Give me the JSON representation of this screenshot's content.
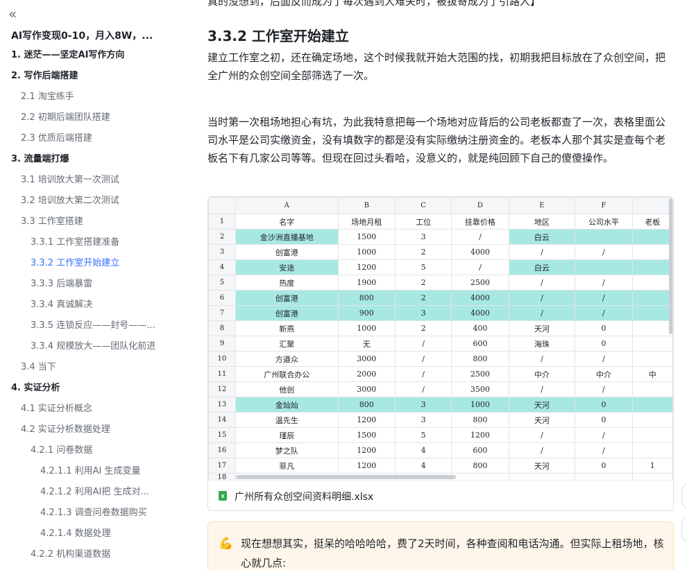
{
  "sidebar": {
    "collapse_icon": "double-chevron-left-icon",
    "collapse_glyph": "«",
    "title": "AI写作变现0-10，月入8W，...",
    "items": [
      {
        "label": "1. 迷茫——坚定AI写作方向",
        "level": 1
      },
      {
        "label": "2. 写作后端搭建",
        "level": 1
      },
      {
        "label": "2.1 淘宝练手",
        "level": 2
      },
      {
        "label": "2.2 初期后端团队搭建",
        "level": 2
      },
      {
        "label": "2.3 优质后端搭建",
        "level": 2
      },
      {
        "label": "3. 流量端打爆",
        "level": 1
      },
      {
        "label": "3.1 培训放大第一次测试",
        "level": 2
      },
      {
        "label": "3.2 培训放大第二次测试",
        "level": 2
      },
      {
        "label": "3.3 工作室搭建",
        "level": 2
      },
      {
        "label": "3.3.1 工作室搭建准备",
        "level": 3
      },
      {
        "label": "3.3.2 工作室开始建立",
        "level": 3,
        "active": true
      },
      {
        "label": "3.3.3 后端暴雷",
        "level": 3
      },
      {
        "label": "3.3.4 真诚解决",
        "level": 3
      },
      {
        "label": "3.3.5 连锁反应——封号——...",
        "level": 3
      },
      {
        "label": "3.3.4 规模放大——团队化前进",
        "level": 3
      },
      {
        "label": "3.4 当下",
        "level": 2
      },
      {
        "label": "4. 实证分析",
        "level": 1
      },
      {
        "label": "4.1 实证分析概念",
        "level": 2
      },
      {
        "label": "4.2 实证分析数据处理",
        "level": 2
      },
      {
        "label": "4.2.1 问卷数据",
        "level": 3
      },
      {
        "label": "4.2.1.1 利用AI 生成变量",
        "level": 4
      },
      {
        "label": "4.2.1.2 利用AI把 生成对...",
        "level": 4
      },
      {
        "label": "4.2.1.3 调查问卷数据购买",
        "level": 4
      },
      {
        "label": "4.2.1.4 数据处理",
        "level": 4
      },
      {
        "label": "4.2.2 机构渠道数据",
        "level": 3
      }
    ]
  },
  "main": {
    "cut_text": "真的没想到，后面反而成为了每次遇到大难关时，被拔寄成为了引路人】",
    "heading": "3.3.2 工作室开始建立",
    "para1": "建立工作室之初，还在确定场地，这个时候我就开始大范围的找，初期我把目标放在了众创空间，把全广州的众创空间全部筛选了一次。",
    "para2": "当时第一次租场地担心有坑，为此我特意把每一个场地对应背后的公司老板都查了一次，表格里面公司水平是公司实缴资金，没有填数字的都是没有实际缴纳注册资金的。老板本人那个其实是查每个老板名下有几家公司等等。但现在回过头看哈，没意义的，就是纯回顾下自己的傻傻操作。"
  },
  "spreadsheet": {
    "col_letters": [
      "A",
      "B",
      "C",
      "D",
      "E",
      "F",
      ""
    ],
    "header_row_num": "1",
    "headers": [
      "名字",
      "场地月租",
      "工位",
      "挂靠价格",
      "地区",
      "公司水平",
      "老板"
    ],
    "highlight_color": "#a7e8e2",
    "rows": [
      {
        "num": "2",
        "cells": [
          "金沙洲直播基地",
          "1500",
          "3",
          "/",
          "白云",
          "",
          ""
        ],
        "hl": [
          true,
          false,
          false,
          false,
          true,
          true,
          true
        ]
      },
      {
        "num": "3",
        "cells": [
          "创富港",
          "1000",
          "2",
          "4000",
          "/",
          "/",
          ""
        ],
        "hl": [
          false,
          false,
          false,
          false,
          false,
          false,
          false
        ]
      },
      {
        "num": "4",
        "cells": [
          "安途",
          "1200",
          "5",
          "/",
          "白云",
          "",
          ""
        ],
        "hl": [
          true,
          false,
          false,
          false,
          true,
          true,
          true
        ]
      },
      {
        "num": "5",
        "cells": [
          "热度",
          "1900",
          "2",
          "2500",
          "/",
          "/",
          ""
        ],
        "hl": [
          false,
          false,
          false,
          false,
          false,
          false,
          false
        ]
      },
      {
        "num": "6",
        "cells": [
          "创富港",
          "800",
          "2",
          "4000",
          "/",
          "/",
          ""
        ],
        "hl": [
          true,
          true,
          true,
          true,
          true,
          true,
          true
        ]
      },
      {
        "num": "7",
        "cells": [
          "创富港",
          "900",
          "3",
          "4000",
          "/",
          "/",
          ""
        ],
        "hl": [
          true,
          true,
          true,
          true,
          true,
          true,
          true
        ]
      },
      {
        "num": "8",
        "cells": [
          "新燕",
          "1000",
          "2",
          "400",
          "天河",
          "0",
          ""
        ],
        "hl": [
          false,
          false,
          false,
          false,
          false,
          false,
          false
        ]
      },
      {
        "num": "9",
        "cells": [
          "汇聚",
          "无",
          "/",
          "600",
          "海珠",
          "0",
          ""
        ],
        "hl": [
          false,
          false,
          false,
          false,
          false,
          false,
          false
        ]
      },
      {
        "num": "10",
        "cells": [
          "方遒众",
          "3000",
          "/",
          "800",
          "/",
          "/",
          ""
        ],
        "hl": [
          false,
          false,
          false,
          false,
          false,
          false,
          false
        ]
      },
      {
        "num": "11",
        "cells": [
          "广州联合办公",
          "2000",
          "/",
          "2500",
          "中介",
          "中介",
          "中"
        ],
        "hl": [
          false,
          false,
          false,
          false,
          false,
          false,
          false
        ]
      },
      {
        "num": "12",
        "cells": [
          "他创",
          "3000",
          "/",
          "3500",
          "/",
          "/",
          ""
        ],
        "hl": [
          false,
          false,
          false,
          false,
          false,
          false,
          false
        ]
      },
      {
        "num": "13",
        "cells": [
          "金灿灿",
          "800",
          "3",
          "1000",
          "天河",
          "0",
          ""
        ],
        "hl": [
          true,
          true,
          true,
          true,
          true,
          true,
          true
        ]
      },
      {
        "num": "14",
        "cells": [
          "温先生",
          "1200",
          "3",
          "800",
          "天河",
          "0",
          ""
        ],
        "hl": [
          false,
          false,
          false,
          false,
          false,
          false,
          false
        ]
      },
      {
        "num": "15",
        "cells": [
          "瑾辰",
          "1500",
          "5",
          "1200",
          "/",
          "/",
          ""
        ],
        "hl": [
          false,
          false,
          false,
          false,
          false,
          false,
          false
        ]
      },
      {
        "num": "16",
        "cells": [
          "梦之队",
          "1200",
          "4",
          "600",
          "/",
          "/",
          ""
        ],
        "hl": [
          false,
          false,
          false,
          false,
          false,
          false,
          false
        ]
      },
      {
        "num": "17",
        "cells": [
          "菲凡",
          "1200",
          "4",
          "800",
          "天河",
          "0",
          "1"
        ],
        "hl": [
          false,
          false,
          false,
          false,
          false,
          false,
          false
        ]
      },
      {
        "num": "18",
        "cells": [
          "",
          "",
          "",
          "",
          "",
          "",
          ""
        ],
        "hl": [
          false,
          false,
          false,
          false,
          false,
          false,
          false
        ]
      }
    ],
    "file_icon": "xlsx-file-icon",
    "file_icon_glyph": "x",
    "file_name": "广州所有众创空间资料明细.xlsx"
  },
  "callout": {
    "icon": "flexed-biceps-icon",
    "icon_glyph": "💪",
    "text": "现在想想其实，挺呆的哈哈哈哈，费了2天时间，各种查阅和电话沟通。但实际上租场地，核心就几点:"
  }
}
